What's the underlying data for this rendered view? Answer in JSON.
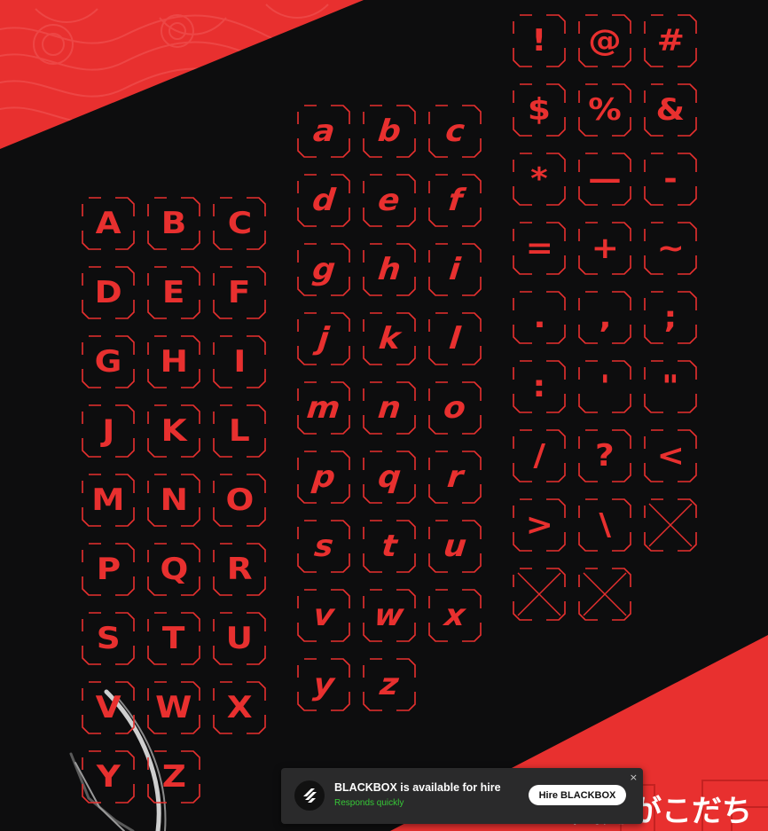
{
  "colors": {
    "accent": "#e8302f",
    "background": "#0d0d0e",
    "wave_line": "#f05a58",
    "card_bg": "#2a2a2b",
    "subtext_green": "#37c837"
  },
  "glyph_sets": {
    "uppercase": [
      "A",
      "B",
      "C",
      "D",
      "E",
      "F",
      "G",
      "H",
      "I",
      "J",
      "K",
      "L",
      "M",
      "N",
      "O",
      "P",
      "Q",
      "R",
      "S",
      "T",
      "U",
      "V",
      "W",
      "X",
      "Y",
      "Z"
    ],
    "lowercase": [
      "a",
      "b",
      "c",
      "d",
      "e",
      "f",
      "g",
      "h",
      "i",
      "j",
      "k",
      "l",
      "m",
      "n",
      "o",
      "p",
      "q",
      "r",
      "s",
      "t",
      "u",
      "v",
      "w",
      "x",
      "y",
      "z"
    ],
    "symbols": [
      "!",
      "@",
      "#",
      "$",
      "%",
      "&",
      "*",
      "—",
      "-",
      "=",
      "+",
      "~",
      ".",
      ",",
      ";",
      ":",
      "'",
      "\"",
      "/",
      "?",
      "<",
      ">",
      "\\",
      "",
      "",
      ""
    ]
  },
  "hire_card": {
    "title": "BLACKBOX is available for hire",
    "subtitle": "Responds quickly",
    "button_label": "Hire BLACKBOX",
    "close_label": "×",
    "logo_icon": "blackbox-logo-icon"
  },
  "overlay_text": {
    "japanese": "ずい気力がこだち"
  }
}
